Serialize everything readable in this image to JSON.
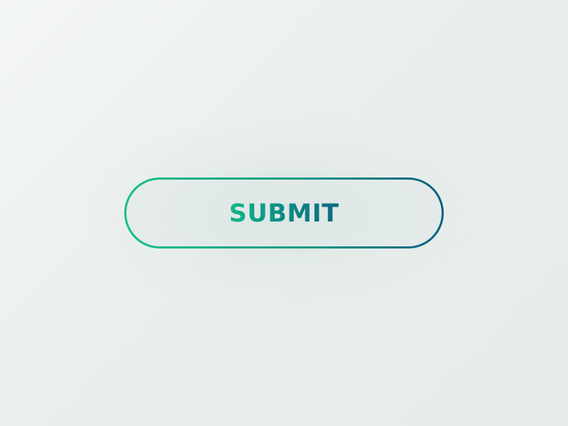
{
  "submit_button": {
    "label": "SUBMIT"
  },
  "colors": {
    "gradient_start": "#14c08a",
    "gradient_end": "#0b5f80",
    "background": "#eef2f0"
  }
}
